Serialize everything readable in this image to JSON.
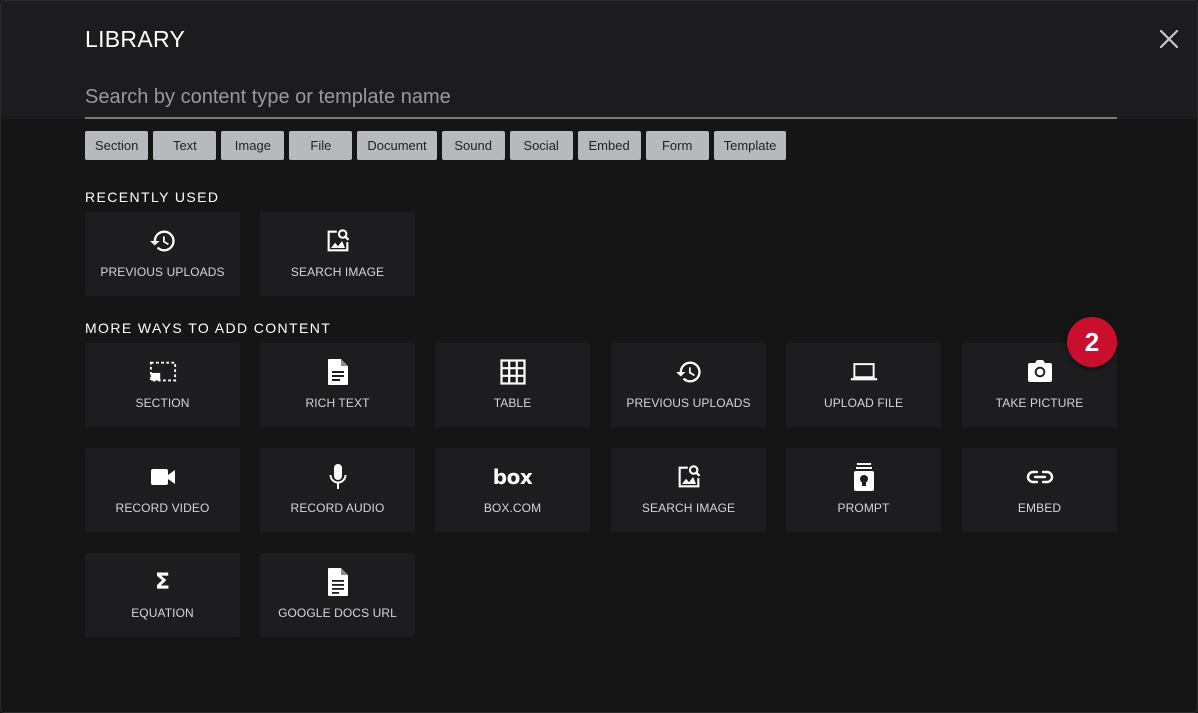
{
  "header": {
    "title": "LIBRARY",
    "search_placeholder": "Search by content type or template name"
  },
  "filters": [
    "Section",
    "Text",
    "Image",
    "File",
    "Document",
    "Sound",
    "Social",
    "Embed",
    "Form",
    "Template"
  ],
  "recently_used": {
    "title": "RECENTLY USED",
    "items": [
      {
        "label": "PREVIOUS UPLOADS",
        "icon": "history-icon"
      },
      {
        "label": "SEARCH IMAGE",
        "icon": "image-search-icon"
      }
    ]
  },
  "more_ways": {
    "title": "MORE WAYS TO ADD CONTENT",
    "items": [
      {
        "label": "SECTION",
        "icon": "section-icon"
      },
      {
        "label": "RICH TEXT",
        "icon": "document-icon"
      },
      {
        "label": "TABLE",
        "icon": "table-icon"
      },
      {
        "label": "PREVIOUS UPLOADS",
        "icon": "history-icon"
      },
      {
        "label": "UPLOAD FILE",
        "icon": "laptop-icon"
      },
      {
        "label": "TAKE PICTURE",
        "icon": "camera-icon"
      },
      {
        "label": "RECORD VIDEO",
        "icon": "video-camera-icon"
      },
      {
        "label": "RECORD AUDIO",
        "icon": "microphone-icon"
      },
      {
        "label": "BOX.COM",
        "icon": "box-logo-icon",
        "glyph": "box"
      },
      {
        "label": "SEARCH IMAGE",
        "icon": "image-search-icon"
      },
      {
        "label": "PROMPT",
        "icon": "prompt-icon"
      },
      {
        "label": "EMBED",
        "icon": "link-icon"
      },
      {
        "label": "EQUATION",
        "icon": "sigma-icon",
        "glyph": "Σ"
      },
      {
        "label": "GOOGLE DOCS URL",
        "icon": "google-doc-icon"
      }
    ]
  },
  "badge": "2",
  "colors": {
    "accent": "#c8102e",
    "chip": "#b7b9bd",
    "tile": "#1d1d1f"
  }
}
